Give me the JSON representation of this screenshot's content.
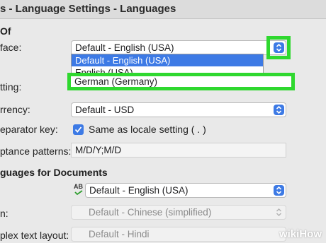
{
  "window": {
    "title": "s - Language Settings - Languages"
  },
  "colors": {
    "accent": "#3d7ae5",
    "highlight": "#2fd82f"
  },
  "languages_of": {
    "heading": "Of",
    "user_interface": {
      "label": "face:",
      "value": "Default - English (USA)",
      "open_list": [
        "Default - English (USA)",
        "English (USA)"
      ],
      "highlighted_option": "German (Germany)"
    },
    "locale_setting": {
      "label": "tting:"
    },
    "currency": {
      "label": "rrency:",
      "value": "Default - USD"
    },
    "decimal_separator": {
      "label": "eparator key:",
      "checkbox_label": "Same as locale setting ( . )",
      "checked": true
    },
    "date_acceptance": {
      "label": "ptance patterns:",
      "value": "M/D/Y;M/D"
    }
  },
  "documents": {
    "heading": "guages for Documents",
    "western": {
      "value": "Default - English (USA)",
      "icon": "spellcheck-ab-icon"
    },
    "asian": {
      "label": "n:",
      "value": "Default - Chinese (simplified)"
    },
    "ctl": {
      "label": "plex text layout:",
      "value": "Default - Hindi"
    }
  },
  "watermark": {
    "wiki": "wiki",
    "how": "How"
  }
}
